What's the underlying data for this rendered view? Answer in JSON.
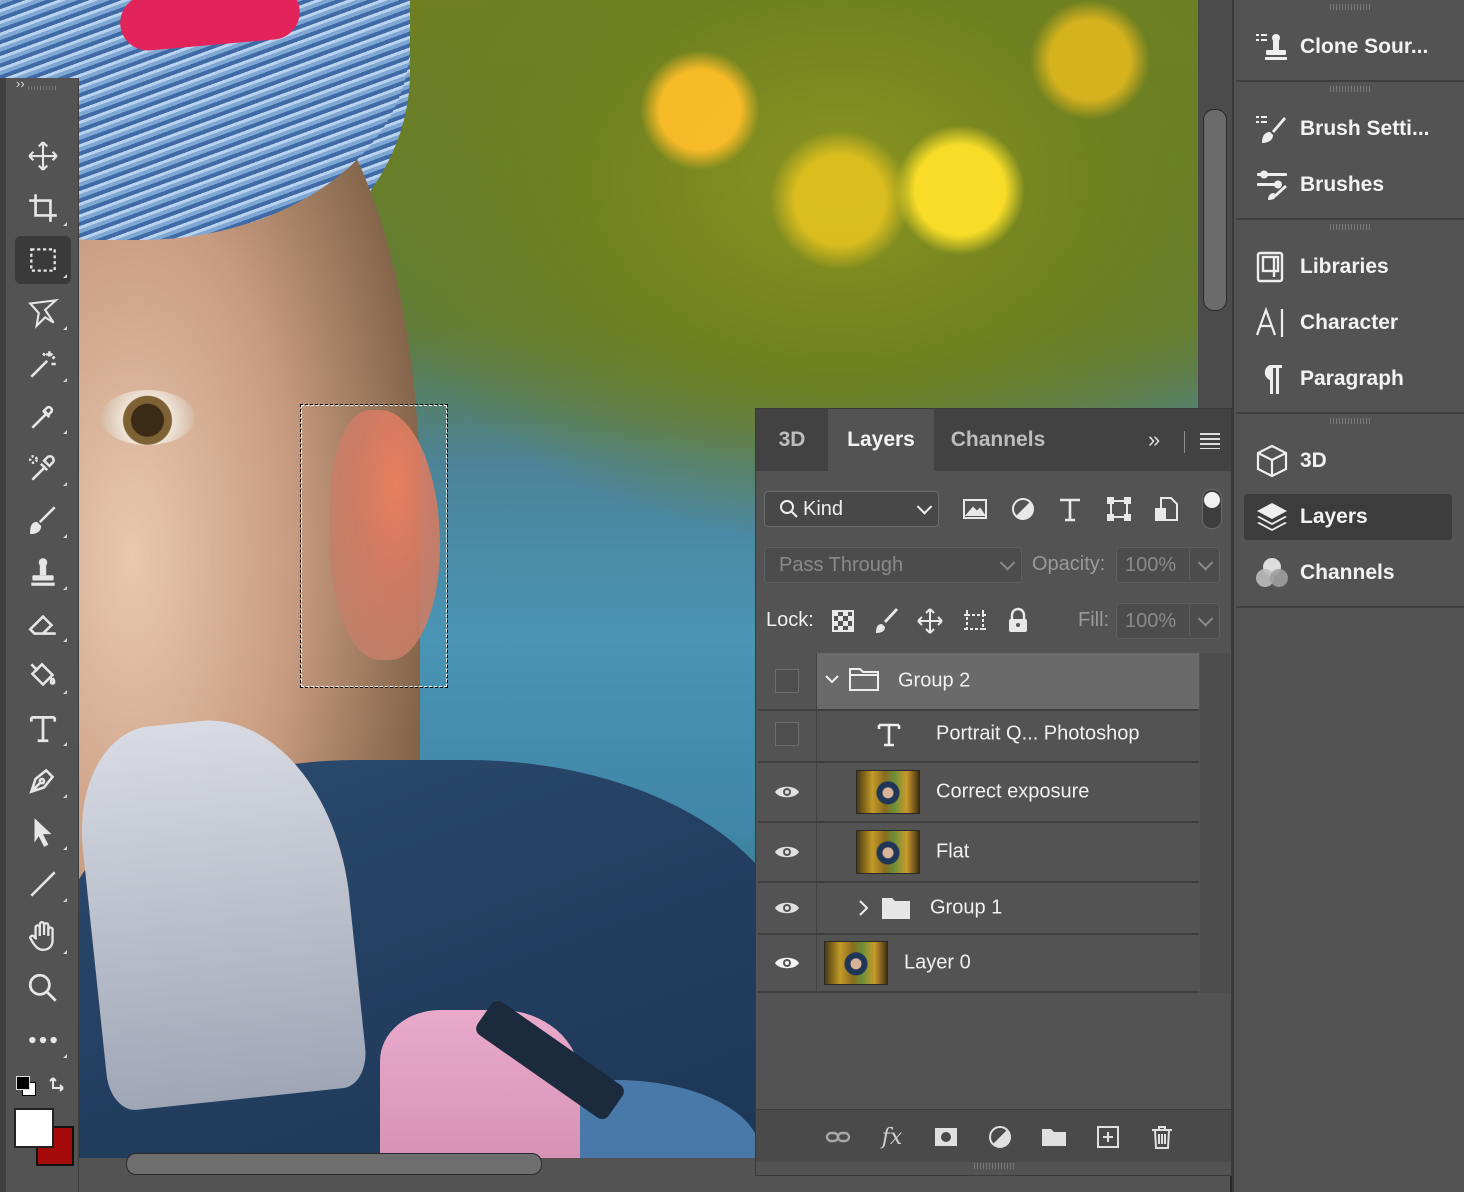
{
  "layers_panel": {
    "tabs": [
      {
        "label": "3D"
      },
      {
        "label": "Layers"
      },
      {
        "label": "Channels"
      }
    ],
    "filter": {
      "kind_label": "Kind"
    },
    "blend_mode": "Pass Through",
    "opacity_label": "Opacity:",
    "opacity_value": "100%",
    "lock_label": "Lock:",
    "fill_label": "Fill:",
    "fill_value": "100%",
    "layers": [
      {
        "name": "Group 2",
        "type": "group",
        "visible": false,
        "expanded": true,
        "selected": true
      },
      {
        "name": "Portrait Q... Photoshop",
        "type": "text",
        "visible": false
      },
      {
        "name": "Correct exposure",
        "type": "pixel",
        "visible": true
      },
      {
        "name": "Flat",
        "type": "pixel",
        "visible": true
      },
      {
        "name": "Group 1",
        "type": "group",
        "visible": true,
        "expanded": false
      },
      {
        "name": "Layer 0",
        "type": "pixel",
        "visible": true
      }
    ]
  },
  "dock": {
    "items": [
      {
        "label": "Clone Sour...",
        "icon": "clone-source-icon"
      },
      {
        "label": "Brush Setti...",
        "icon": "brush-settings-icon"
      },
      {
        "label": "Brushes",
        "icon": "brushes-icon"
      },
      {
        "label": "Libraries",
        "icon": "libraries-icon"
      },
      {
        "label": "Character",
        "icon": "character-icon"
      },
      {
        "label": "Paragraph",
        "icon": "paragraph-icon"
      },
      {
        "label": "3D",
        "icon": "3d-icon"
      },
      {
        "label": "Layers",
        "icon": "layers-icon",
        "selected": true
      },
      {
        "label": "Channels",
        "icon": "channels-icon"
      }
    ]
  },
  "toolbar": {
    "tools": [
      "move-tool",
      "crop-tool",
      "rectangular-marquee-tool",
      "lasso-tool",
      "magic-wand-tool",
      "eyedropper-tool",
      "spot-healing-tool",
      "brush-tool",
      "clone-stamp-tool",
      "eraser-tool",
      "paint-bucket-tool",
      "type-tool",
      "pen-tool",
      "path-selection-tool",
      "line-tool",
      "hand-tool",
      "zoom-tool",
      "more-tools"
    ],
    "active_tool": "rectangular-marquee-tool",
    "foreground_color": "#ffffff",
    "background_color": "#a50b0b"
  },
  "colors": {
    "panel_bg": "#535353",
    "selected_row": "#6a6a6a"
  }
}
